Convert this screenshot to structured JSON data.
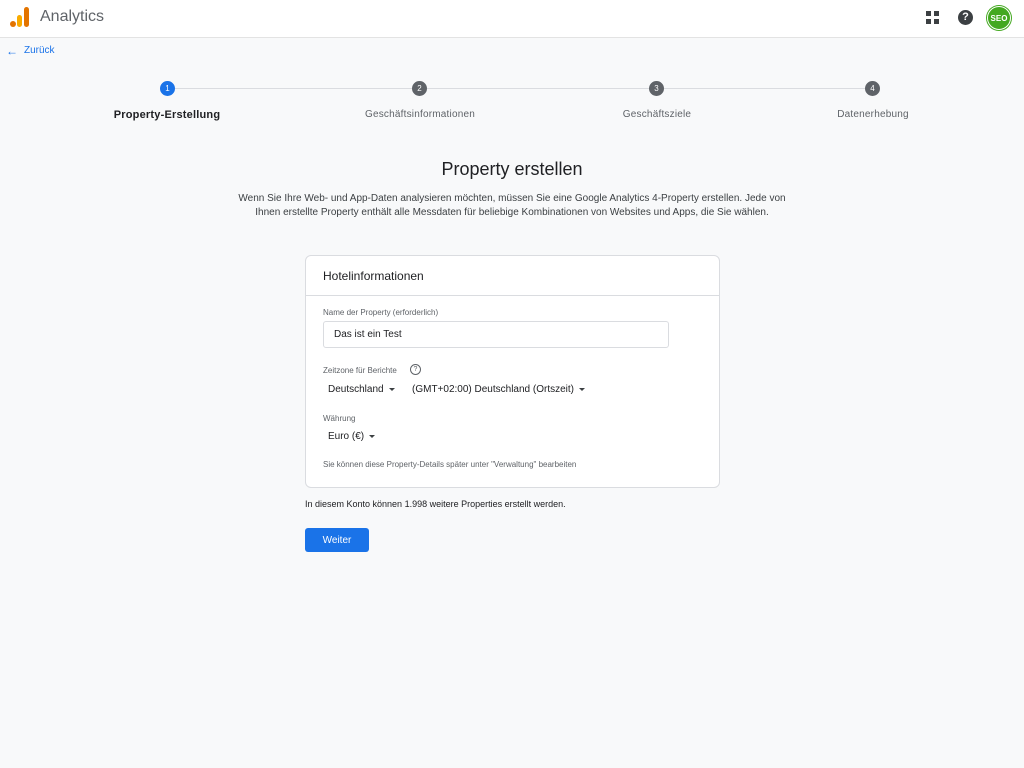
{
  "app": {
    "title": "Analytics"
  },
  "header": {
    "avatar_text": "SEO",
    "help_glyph": "?"
  },
  "nav": {
    "back_label": "Zurück",
    "back_arrow": "←"
  },
  "stepper": {
    "steps": [
      {
        "number": "1",
        "label": "Property-Erstellung",
        "active": true
      },
      {
        "number": "2",
        "label": "Geschäftsinformationen",
        "active": false
      },
      {
        "number": "3",
        "label": "Geschäftsziele",
        "active": false
      },
      {
        "number": "4",
        "label": "Datenerhebung",
        "active": false
      }
    ]
  },
  "main": {
    "title": "Property erstellen",
    "intro": "Wenn Sie Ihre Web- und App-Daten analysieren möchten, müssen Sie eine Google Analytics 4-Property erstellen. Jede von Ihnen erstellte Property enthält alle Messdaten für beliebige Kombinationen von Websites und Apps, die Sie wählen."
  },
  "card": {
    "header": "Hotelinformationen",
    "property_name": {
      "label": "Name der Property (erforderlich)",
      "value": "Das ist ein Test"
    },
    "timezone": {
      "label": "Zeitzone für Berichte",
      "help_glyph": "?",
      "country": "Deutschland",
      "zone": "(GMT+02:00) Deutschland (Ortszeit)"
    },
    "currency": {
      "label": "Währung",
      "value": "Euro (€)"
    },
    "note": "Sie können diese Property-Details später unter \"Verwaltung\" bearbeiten"
  },
  "footer": {
    "remaining_text": "In diesem Konto können 1.998 weitere Properties erstellt werden.",
    "next_label": "Weiter"
  },
  "colors": {
    "accent": "#1a73e8",
    "avatar": "#43a820",
    "logo_orange": "#e37400",
    "logo_yellow": "#f9ab00"
  },
  "icons": [
    "analytics-logo-icon",
    "apps-grid-icon",
    "help-icon",
    "arrow-back-icon",
    "caret-down-icon",
    "question-circle-icon"
  ]
}
